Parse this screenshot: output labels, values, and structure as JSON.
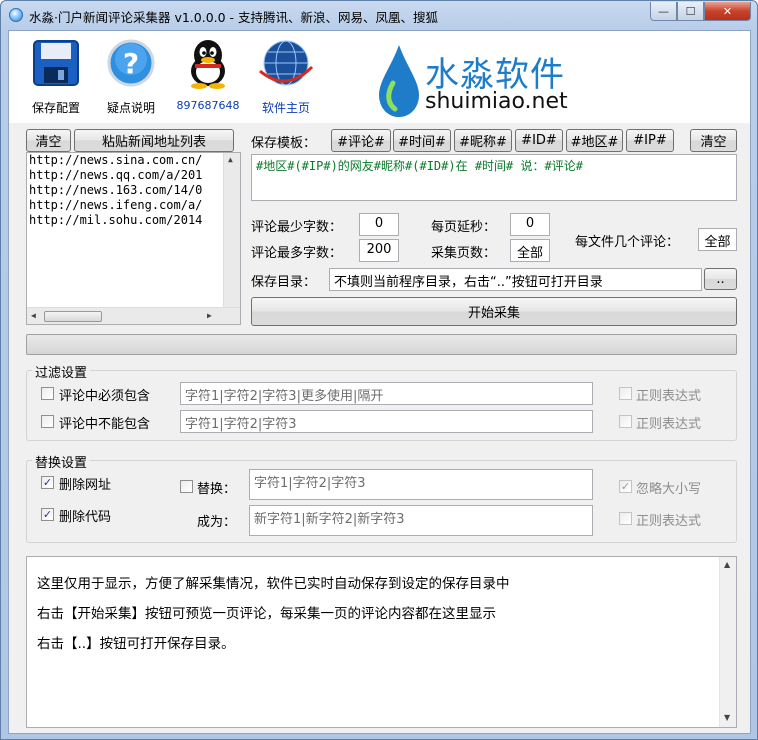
{
  "window": {
    "title": "水淼·门户新闻评论采集器 v1.0.0.0 - 支持腾讯、新浪、网易、凤凰、搜狐",
    "close_glyph": "✕",
    "min_glyph": "—",
    "max_glyph": "☐"
  },
  "toolbar": {
    "save_config": "保存配置",
    "help": "疑点说明",
    "qq": "897687648",
    "homepage": "软件主页"
  },
  "brand": {
    "cn": "水淼软件",
    "en": "shuimiao.net"
  },
  "urls": {
    "clear": "清空",
    "paste": "粘贴新闻地址列表",
    "items": [
      "http://news.sina.com.cn/",
      "http://news.qq.com/a/201",
      "http://news.163.com/14/0",
      "http://news.ifeng.com/a/",
      "http://mil.sohu.com/2014"
    ]
  },
  "template": {
    "label": "保存模板：",
    "tags": [
      "#评论#",
      "#时间#",
      "#昵称#",
      "#ID#",
      "#地区#",
      "#IP#"
    ],
    "clear": "清空",
    "value": "#地区#(#IP#)的网友#昵称#(#ID#)在 #时间# 说：#评论#"
  },
  "params": {
    "min_chars_label": "评论最少字数：",
    "min_chars": "0",
    "max_chars_label": "评论最多字数：",
    "max_chars": "200",
    "delay_label": "每页延秒：",
    "delay": "0",
    "pages_label": "采集页数：",
    "pages": "全部",
    "per_file_label": "每文件几个评论：",
    "per_file": "全部"
  },
  "save_dir": {
    "label": "保存目录：",
    "value": "不填则当前程序目录，右击“..”按钮可打开目录",
    "browse": ".."
  },
  "start_button": "开始采集",
  "filter": {
    "title": "过滤设置",
    "must_contain": "评论中必须包含",
    "must_contain_value": "字符1|字符2|字符3|更多使用|隔开",
    "not_contain": "评论中不能包含",
    "not_contain_value": "字符1|字符2|字符3",
    "regex1": "正则表达式",
    "regex2": "正则表达式"
  },
  "replace": {
    "title": "替换设置",
    "remove_url": "删除网址",
    "remove_code": "删除代码",
    "replace_label": "替换：",
    "replace_value": "字符1|字符2|字符3",
    "become_label": "成为：",
    "become_value": "新字符1|新字符2|新字符3",
    "ignore_case": "忽略大小写",
    "regex": "正则表达式",
    "check_glyph": "✓"
  },
  "log": {
    "lines": [
      "这里仅用于显示，方便了解采集情况，软件已实时自动保存到设定的保存目录中",
      "右击【开始采集】按钮可预览一页评论，每采集一页的评论内容都在这里显示",
      "右击【..】按钮可打开保存目录。"
    ]
  },
  "colors": {
    "accent": "#1f7cc8",
    "template_text": "#0a7a2b"
  }
}
